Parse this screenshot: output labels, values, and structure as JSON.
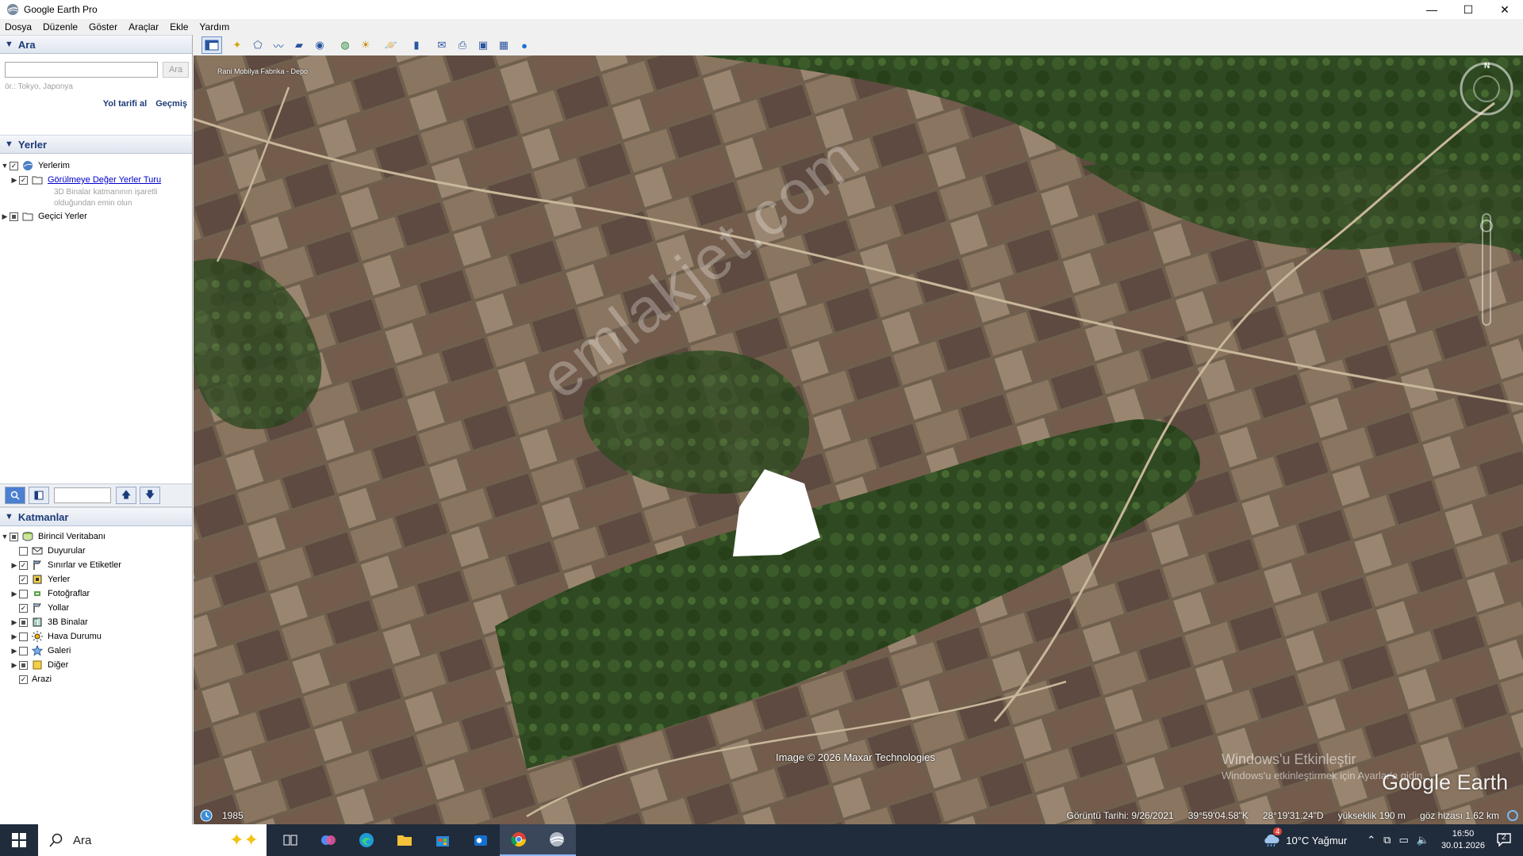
{
  "window": {
    "title": "Google Earth Pro",
    "controls": [
      "—",
      "☐",
      "✕"
    ]
  },
  "menu": [
    "Dosya",
    "Düzenle",
    "Göster",
    "Araçlar",
    "Ekle",
    "Yardım"
  ],
  "search": {
    "header": "Ara",
    "button": "Ara",
    "hint": "ör.: Tokyo, Japonya",
    "link_directions": "Yol tarifi al",
    "link_history": "Geçmiş"
  },
  "places": {
    "header": "Yerler",
    "items": [
      {
        "label": "Yerlerim"
      },
      {
        "label": "Görülmeye Değer Yerler Turu",
        "note_line1": "3D Binalar katmanının işaretli",
        "note_line2": "olduğundan emin olun"
      },
      {
        "label": "Geçici Yerler"
      }
    ]
  },
  "layers": {
    "header": "Katmanlar",
    "root": "Birincil Veritabanı",
    "items": [
      {
        "label": "Duyurular",
        "checked": false
      },
      {
        "label": "Sınırlar ve Etiketler",
        "checked": true
      },
      {
        "label": "Yerler",
        "checked": true
      },
      {
        "label": "Fotoğraflar",
        "checked": false
      },
      {
        "label": "Yollar",
        "checked": true
      },
      {
        "label": "3B Binalar",
        "checked": "partial"
      },
      {
        "label": "Hava Durumu",
        "checked": false
      },
      {
        "label": "Galeri",
        "checked": false
      },
      {
        "label": "Diğer",
        "checked": "partial"
      },
      {
        "label": "Arazi",
        "checked": true
      }
    ]
  },
  "map": {
    "place_label": "Rani Mobilya Fabrika - Depo",
    "watermark": "emlakjet.com",
    "credit": "Image © 2026 Maxar Technologies",
    "logo": "Google Earth",
    "compass_n": "N",
    "activation_line1": "Windows'u Etkinleştir",
    "activation_line2": "Windows'u etkinleştirmek için Ayarlar'a gidin.",
    "status": {
      "year": "1985",
      "imagery_date": "Görüntü Tarihi: 9/26/2021",
      "lat": "39°59'04.58\"K",
      "lon": "28°19'31.24\"D",
      "elevation": "yükseklik   190 m",
      "eye_alt": "göz hizası   1.62 km"
    }
  },
  "taskbar": {
    "search": "Ara",
    "weather": "10°C  Yağmur",
    "weather_badge": "4",
    "time": "16:50",
    "date": "30.01.2026",
    "notif": "2"
  }
}
